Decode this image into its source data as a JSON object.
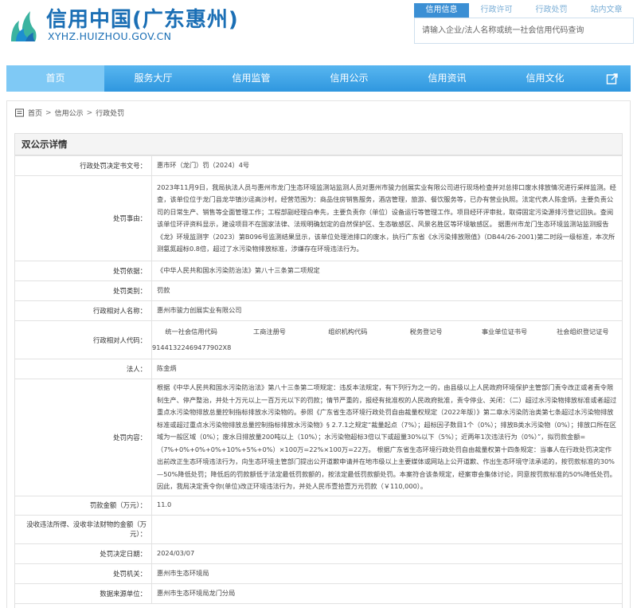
{
  "header": {
    "site_title": "信用中国(广东惠州)",
    "domain": "XYHZ.HUIZHOU.GOV.CN",
    "search_tabs": [
      "信用信息",
      "行政许可",
      "行政处罚",
      "站内文章"
    ],
    "search_placeholder": "请输入企业/法人名称或统一社会信用代码查询"
  },
  "nav": {
    "items": [
      "首页",
      "服务大厅",
      "信用监管",
      "信用公示",
      "信用资讯",
      "信用文化"
    ]
  },
  "breadcrumb": [
    "首页",
    "信用公示",
    "行政处罚"
  ],
  "detail": {
    "title": "双公示详情",
    "rows": {
      "doc_no_label": "行政处罚决定书文号：",
      "doc_no": "惠市环（龙门）罚（2024）4号",
      "reason_label": "处罚事由：",
      "reason": "2023年11月9日，我局执法人员与惠州市龙门生态环境监测站监测人员对惠州市骏力创展实业有限公司进行现场检查并对总排口废水排放情况进行采样监测。经查，该单位位于龙门县龙华镇沙迳高沙村，经营范围为：商品住房销售服务，酒店管理，旅游、餐饮服务等，已办有营业执照。法定代表人陈金炳，主要负责公司的日常生产、销售等全面管理工作；工程部副经理白奉先，主要负责你（单位）设备运行等管理工作。项目经环评审批，取得固定污染源排污登记回执。查阅该单位环评资料显示，建设项目不在国家法律、法规明确划定的自然保护区、生态敏感区、风景名胜区等环境敏感区。 据惠州市龙门生态环境监测站监测报告《龙》环境监测字（2023）第B096号监测结果显示，该单位处理池排口的废水，执行广东省《水污染排放限值》（DB44/26-2001)第二时段一级标准，本次所测氨氮超标0.8倍，超过了水污染物排放标准，涉嫌存在环境违法行为。",
      "basis_label": "处罚依据：",
      "basis": "《中华人民共和国水污染防治法》第八十三条第二项规定",
      "category_label": "处罚类别：",
      "category": "罚款",
      "party_label": "行政相对人名称：",
      "party": "惠州市骏力创展实业有限公司",
      "code_label": "行政相对人代码：",
      "code_headers": [
        "统一社会信用代码",
        "工商注册号",
        "组织机构代码",
        "税务登记号",
        "事业单位证书号",
        "社会组织登记证号"
      ],
      "code_values": [
        "91441322469477902X8",
        "",
        "",
        "",
        "",
        ""
      ],
      "legal_label": "法人：",
      "legal": "陈金炳",
      "content_label": "处罚内容：",
      "content": "根据《中华人民共和国水污染防治法》第八十三条第二项规定：违反本法规定，有下列行为之一的，由县级以上人民政府环境保护主管部门责令改正或者责令限制生产、停产整治，并处十万元以上一百万元以下的罚款；情节严重的，报经有批准权的人民政府批准，责令停业、关闭：（二）超过水污染物排放标准或者超过重点水污染物排放总量控制指标排放水污染物的。参照《广东省生态环境行政处罚自由裁量权规定（2022年版）》第二章水污染防治类第七条超过水污染物排放标准或超过重点水污染物排放总量控制指标排放水污染物》§ 2.7.1之规定“裁量起点（7%）；超标因子数目1个（0%）；排放B类水污染物（0%）；排放口所在区域为一般区域（0%）；废水日排放量200吨以上（10%）；水污染物超标3倍以下或超量30%以下（5%）；近两年1次违法行为（0%）”，拟罚款金额=（7%+0%+0%+0%+10%+5%+0%）×100万=22%×100万=22万。 根据广东省生态环境行政处罚自由裁量权第十四条规定：当事人在行政处罚决定作出前改正生态环境违法行为，向生态环境主管部门提出公开道歉申请并在地市级以上主要媒体或网站上公开道歉、作出生态环境守法承诺的，按罚款标准的30%—50%降低处罚；降低后的罚款额低于法定最低罚款额的，按法定最低罚款额处罚。本案符合该条规定，经案审会集体讨论，同意按罚款标准的50%降低处罚。因此，我局决定责令你(单位)改正环境违法行为，并处人民币壹拾壹万元罚款（￥110,000）。",
      "fine_label": "罚款金额（万元）：",
      "fine": "11.0",
      "confiscate_label": "没收违法所得、没收非法财物的金额（万元）：",
      "confiscate": "",
      "date_label": "处罚决定日期：",
      "date": "2024/03/07",
      "authority_label": "处罚机关：",
      "authority": "惠州市生态环境局",
      "source_label": "数据来源单位：",
      "source": "惠州市生态环境局龙门分局"
    }
  },
  "colors": {
    "brand": "#1b6fb5",
    "nav_bg": "#3aa1e4",
    "nav_active": "#7fc9f5",
    "tab_active": "#3b8fd4"
  }
}
